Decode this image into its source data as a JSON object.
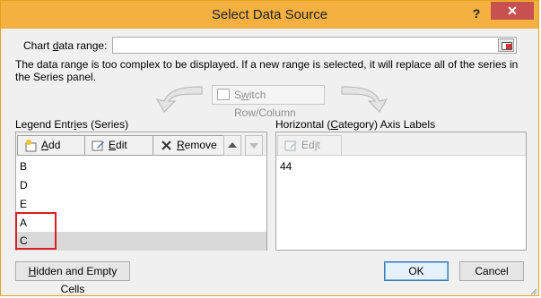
{
  "window": {
    "title": "Select Data Source",
    "help": "?",
    "close": "✕"
  },
  "chart_range": {
    "label_pre": "Chart ",
    "label_u": "d",
    "label_post": "ata range:",
    "value": ""
  },
  "message": "The data range is too complex to be displayed. If a new range is selected, it will replace all of the series in the Series panel.",
  "switch": {
    "u": "w",
    "pre": "S",
    "post": "itch Row/Column"
  },
  "legend": {
    "header_pre": "Legend Entr",
    "header_u": "i",
    "header_post": "es (Series)",
    "add": {
      "u": "A",
      "post": "dd"
    },
    "edit": {
      "u": "E",
      "post": "dit"
    },
    "remove": {
      "u": "R",
      "post": "emove"
    },
    "items": [
      "B",
      "D",
      "E",
      "A",
      "C"
    ],
    "selected_index": 4
  },
  "axis": {
    "header_pre": "Horizontal (",
    "header_u": "C",
    "header_post": "ategory) Axis Labels",
    "edit": {
      "pre": "Ed",
      "u": "i",
      "post": "t"
    },
    "items": [
      "44"
    ]
  },
  "footer": {
    "hidden_u": "H",
    "hidden_post": "idden and Empty Cells",
    "ok": "OK",
    "cancel": "Cancel"
  }
}
